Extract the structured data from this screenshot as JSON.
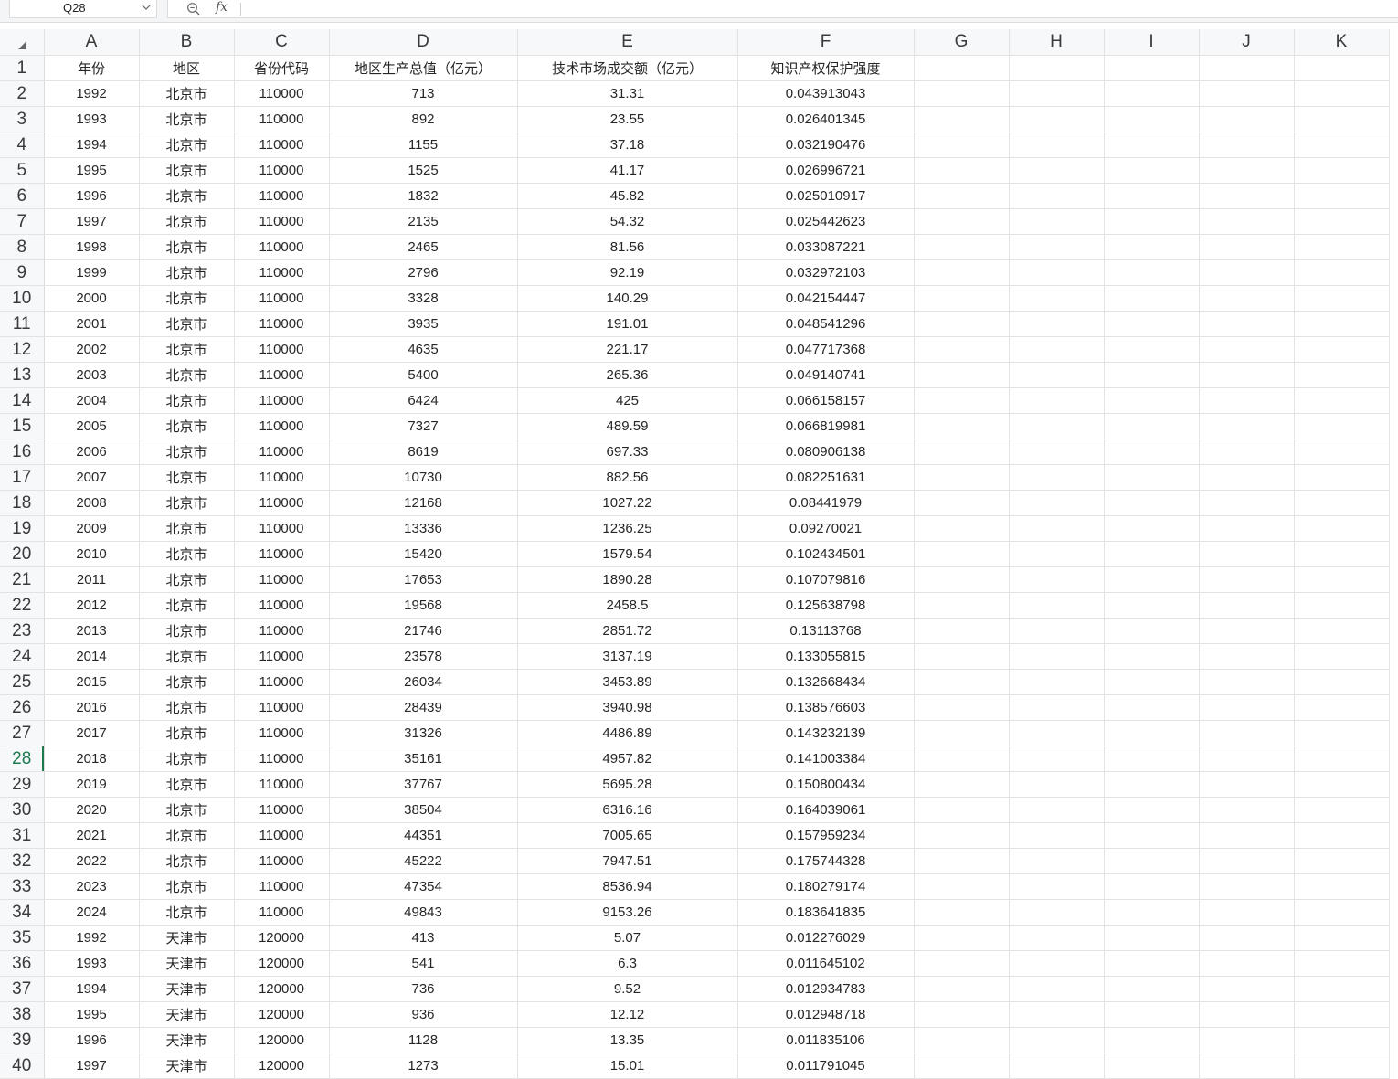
{
  "formula_bar": {
    "name_box": "Q28",
    "fx_label": "fx",
    "formula": ""
  },
  "columns": [
    "A",
    "B",
    "C",
    "D",
    "E",
    "F",
    "G",
    "H",
    "I",
    "J",
    "K"
  ],
  "active_row": 28,
  "rows": [
    {
      "num": "1",
      "cells": [
        "年份",
        "地区",
        "省份代码",
        "地区生产总值（亿元）",
        "技术市场成交额（亿元）",
        "知识产权保护强度"
      ]
    },
    {
      "num": "2",
      "cells": [
        "1992",
        "北京市",
        "110000",
        "713",
        "31.31",
        "0.043913043"
      ]
    },
    {
      "num": "3",
      "cells": [
        "1993",
        "北京市",
        "110000",
        "892",
        "23.55",
        "0.026401345"
      ]
    },
    {
      "num": "4",
      "cells": [
        "1994",
        "北京市",
        "110000",
        "1155",
        "37.18",
        "0.032190476"
      ]
    },
    {
      "num": "5",
      "cells": [
        "1995",
        "北京市",
        "110000",
        "1525",
        "41.17",
        "0.026996721"
      ]
    },
    {
      "num": "6",
      "cells": [
        "1996",
        "北京市",
        "110000",
        "1832",
        "45.82",
        "0.025010917"
      ]
    },
    {
      "num": "7",
      "cells": [
        "1997",
        "北京市",
        "110000",
        "2135",
        "54.32",
        "0.025442623"
      ]
    },
    {
      "num": "8",
      "cells": [
        "1998",
        "北京市",
        "110000",
        "2465",
        "81.56",
        "0.033087221"
      ]
    },
    {
      "num": "9",
      "cells": [
        "1999",
        "北京市",
        "110000",
        "2796",
        "92.19",
        "0.032972103"
      ]
    },
    {
      "num": "10",
      "cells": [
        "2000",
        "北京市",
        "110000",
        "3328",
        "140.29",
        "0.042154447"
      ]
    },
    {
      "num": "11",
      "cells": [
        "2001",
        "北京市",
        "110000",
        "3935",
        "191.01",
        "0.048541296"
      ]
    },
    {
      "num": "12",
      "cells": [
        "2002",
        "北京市",
        "110000",
        "4635",
        "221.17",
        "0.047717368"
      ]
    },
    {
      "num": "13",
      "cells": [
        "2003",
        "北京市",
        "110000",
        "5400",
        "265.36",
        "0.049140741"
      ]
    },
    {
      "num": "14",
      "cells": [
        "2004",
        "北京市",
        "110000",
        "6424",
        "425",
        "0.066158157"
      ]
    },
    {
      "num": "15",
      "cells": [
        "2005",
        "北京市",
        "110000",
        "7327",
        "489.59",
        "0.066819981"
      ]
    },
    {
      "num": "16",
      "cells": [
        "2006",
        "北京市",
        "110000",
        "8619",
        "697.33",
        "0.080906138"
      ]
    },
    {
      "num": "17",
      "cells": [
        "2007",
        "北京市",
        "110000",
        "10730",
        "882.56",
        "0.082251631"
      ]
    },
    {
      "num": "18",
      "cells": [
        "2008",
        "北京市",
        "110000",
        "12168",
        "1027.22",
        "0.08441979"
      ]
    },
    {
      "num": "19",
      "cells": [
        "2009",
        "北京市",
        "110000",
        "13336",
        "1236.25",
        "0.09270021"
      ]
    },
    {
      "num": "20",
      "cells": [
        "2010",
        "北京市",
        "110000",
        "15420",
        "1579.54",
        "0.102434501"
      ]
    },
    {
      "num": "21",
      "cells": [
        "2011",
        "北京市",
        "110000",
        "17653",
        "1890.28",
        "0.107079816"
      ]
    },
    {
      "num": "22",
      "cells": [
        "2012",
        "北京市",
        "110000",
        "19568",
        "2458.5",
        "0.125638798"
      ]
    },
    {
      "num": "23",
      "cells": [
        "2013",
        "北京市",
        "110000",
        "21746",
        "2851.72",
        "0.13113768"
      ]
    },
    {
      "num": "24",
      "cells": [
        "2014",
        "北京市",
        "110000",
        "23578",
        "3137.19",
        "0.133055815"
      ]
    },
    {
      "num": "25",
      "cells": [
        "2015",
        "北京市",
        "110000",
        "26034",
        "3453.89",
        "0.132668434"
      ]
    },
    {
      "num": "26",
      "cells": [
        "2016",
        "北京市",
        "110000",
        "28439",
        "3940.98",
        "0.138576603"
      ]
    },
    {
      "num": "27",
      "cells": [
        "2017",
        "北京市",
        "110000",
        "31326",
        "4486.89",
        "0.143232139"
      ]
    },
    {
      "num": "28",
      "cells": [
        "2018",
        "北京市",
        "110000",
        "35161",
        "4957.82",
        "0.141003384"
      ]
    },
    {
      "num": "29",
      "cells": [
        "2019",
        "北京市",
        "110000",
        "37767",
        "5695.28",
        "0.150800434"
      ]
    },
    {
      "num": "30",
      "cells": [
        "2020",
        "北京市",
        "110000",
        "38504",
        "6316.16",
        "0.164039061"
      ]
    },
    {
      "num": "31",
      "cells": [
        "2021",
        "北京市",
        "110000",
        "44351",
        "7005.65",
        "0.157959234"
      ]
    },
    {
      "num": "32",
      "cells": [
        "2022",
        "北京市",
        "110000",
        "45222",
        "7947.51",
        "0.175744328"
      ]
    },
    {
      "num": "33",
      "cells": [
        "2023",
        "北京市",
        "110000",
        "47354",
        "8536.94",
        "0.180279174"
      ]
    },
    {
      "num": "34",
      "cells": [
        "2024",
        "北京市",
        "110000",
        "49843",
        "9153.26",
        "0.183641835"
      ]
    },
    {
      "num": "35",
      "cells": [
        "1992",
        "天津市",
        "120000",
        "413",
        "5.07",
        "0.012276029"
      ]
    },
    {
      "num": "36",
      "cells": [
        "1993",
        "天津市",
        "120000",
        "541",
        "6.3",
        "0.011645102"
      ]
    },
    {
      "num": "37",
      "cells": [
        "1994",
        "天津市",
        "120000",
        "736",
        "9.52",
        "0.012934783"
      ]
    },
    {
      "num": "38",
      "cells": [
        "1995",
        "天津市",
        "120000",
        "936",
        "12.12",
        "0.012948718"
      ]
    },
    {
      "num": "39",
      "cells": [
        "1996",
        "天津市",
        "120000",
        "1128",
        "13.35",
        "0.011835106"
      ]
    },
    {
      "num": "40",
      "cells": [
        "1997",
        "天津市",
        "120000",
        "1273",
        "15.01",
        "0.011791045"
      ]
    }
  ]
}
